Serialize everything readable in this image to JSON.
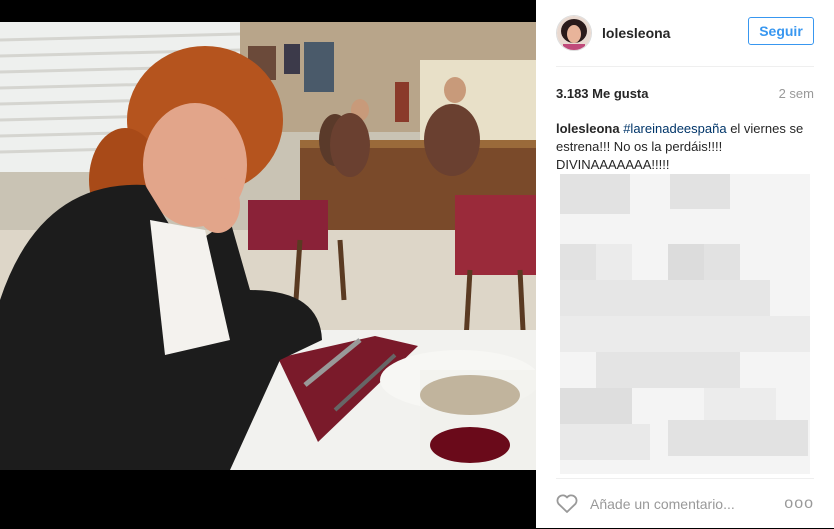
{
  "post": {
    "username": "lolesleona",
    "follow_label": "Seguir",
    "likes": "3.183 Me gusta",
    "time_ago": "2 sem",
    "caption_user": "lolesleona",
    "caption_tag": "#lareinadeespaña",
    "caption_text_1": " el viernes se estrena!!! No os la perdáis!!!! DIVINAAAAAAA!!!!!",
    "comment_placeholder": "Añade un comentario...",
    "more_label": "ooo"
  },
  "colors": {
    "accent": "#3897f0",
    "text": "#262626",
    "muted": "#999999"
  },
  "icons": {
    "like": "heart-icon",
    "options": "more-options-icon"
  }
}
